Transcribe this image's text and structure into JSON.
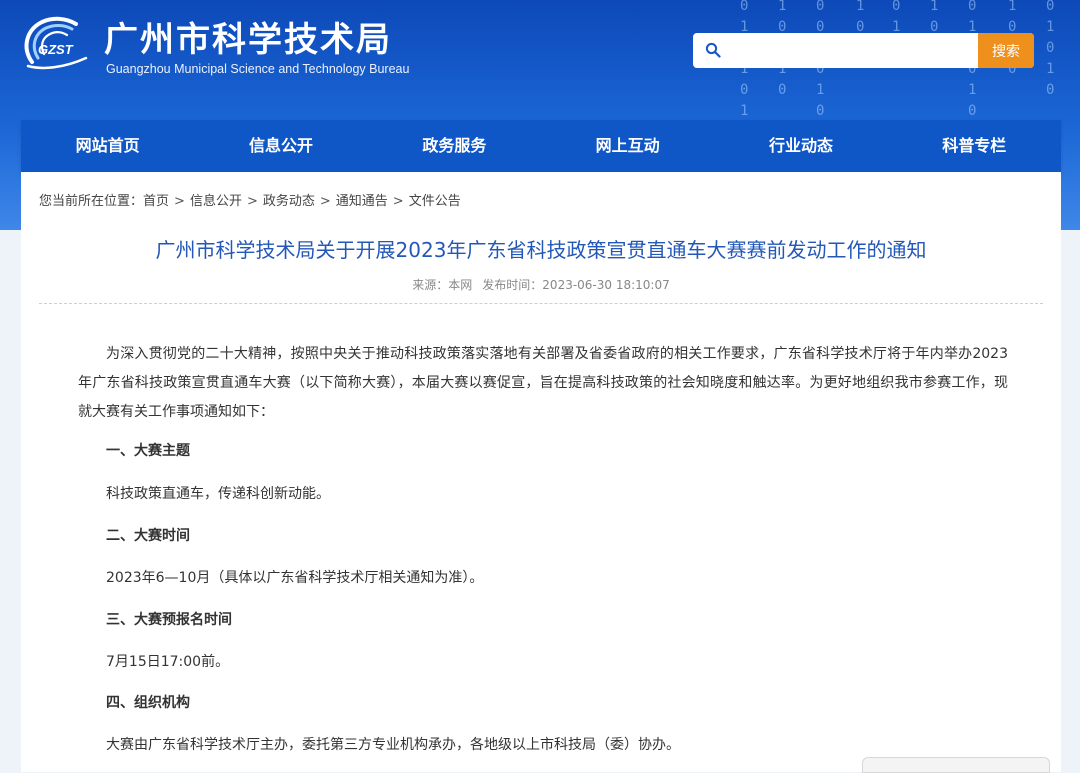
{
  "header": {
    "logo_text": "GZST",
    "title": "广州市科学技术局",
    "subtitle": "Guangzhou Municipal Science and Technology Bureau",
    "colors": {
      "primary": "#0f56c6",
      "accent": "#f0901c",
      "title_link": "#2358b8"
    }
  },
  "search": {
    "icon": "search-icon",
    "placeholder": "",
    "value": "",
    "button_label": "搜索"
  },
  "nav": {
    "items": [
      "网站首页",
      "信息公开",
      "政务服务",
      "网上互动",
      "行业动态",
      "科普专栏"
    ]
  },
  "breadcrumb": {
    "prefix": "您当前所在位置：",
    "items": [
      "首页",
      "信息公开",
      "政务动态",
      "通知通告",
      "文件公告"
    ],
    "separator": ">"
  },
  "article": {
    "title": "广州市科学技术局关于开展2023年广东省科技政策宣贯直通车大赛赛前发动工作的通知",
    "source_label": "来源：",
    "source_value": "本网",
    "time_label": "发布时间：",
    "time_value": "2023-06-30 18:10:07",
    "intro": "为深入贯彻党的二十大精神，按照中央关于推动科技政策落实落地有关部署及省委省政府的相关工作要求，广东省科学技术厅将于年内举办2023年广东省科技政策宣贯直通车大赛（以下简称大赛），本届大赛以赛促宣，旨在提高科技政策的社会知晓度和触达率。为更好地组织我市参赛工作，现就大赛有关工作事项通知如下：",
    "sections": [
      {
        "heading": "一、大赛主题",
        "text": "科技政策直通车，传递科创新动能。"
      },
      {
        "heading": "二、大赛时间",
        "text": "2023年6—10月（具体以广东省科学技术厅相关通知为准）。"
      },
      {
        "heading": "三、大赛预报名时间",
        "text": "7月15日17:00前。"
      },
      {
        "heading": "四、组织机构",
        "text": "大赛由广东省科学技术厅主办，委托第三方专业机构承办，各地级以上市科技局（委）协办。"
      }
    ]
  }
}
